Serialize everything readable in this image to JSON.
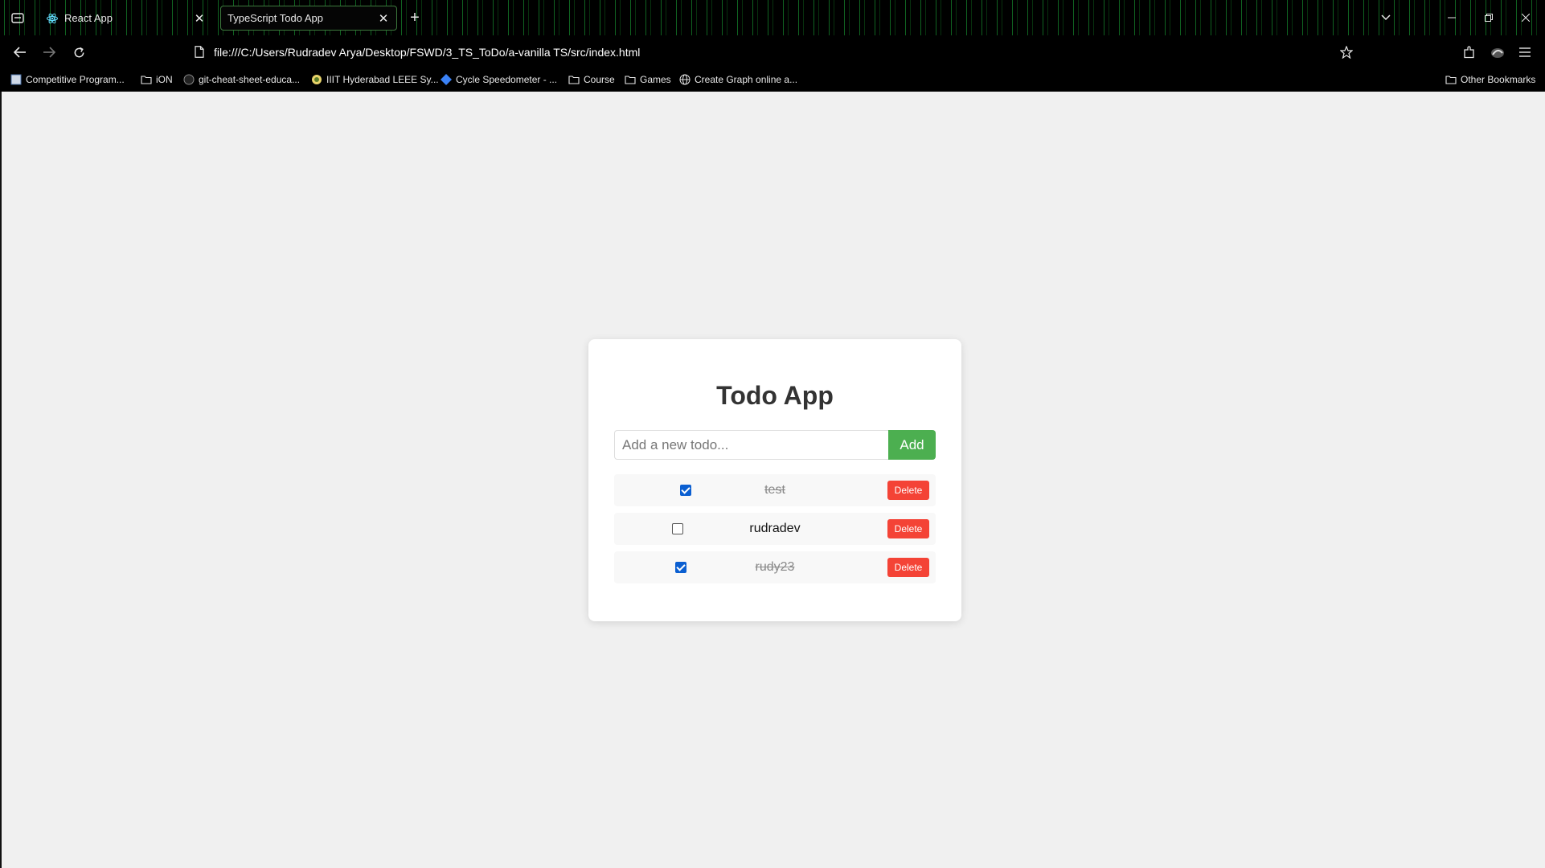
{
  "browser": {
    "tabs": [
      {
        "label": "React App",
        "active": false
      },
      {
        "label": "TypeScript Todo App",
        "active": true
      }
    ],
    "address": "file:///C:/Users/Rudradev Arya/Desktop/FSWD/3_TS_ToDo/a-vanilla TS/src/index.html",
    "bookmarks": [
      {
        "label": "Competitive Program...",
        "icon": "site-icon"
      },
      {
        "label": "iON",
        "icon": "folder-icon"
      },
      {
        "label": "git-cheat-sheet-educa...",
        "icon": "github-icon"
      },
      {
        "label": "IIIT Hyderabad LEEE Sy...",
        "icon": "site-icon"
      },
      {
        "label": "Cycle Speedometer - ...",
        "icon": "diamond-icon"
      },
      {
        "label": "Course",
        "icon": "folder-icon"
      },
      {
        "label": "Games",
        "icon": "folder-icon"
      },
      {
        "label": "Create Graph online a...",
        "icon": "globe-icon"
      }
    ],
    "other_bookmarks": "Other Bookmarks"
  },
  "app": {
    "title": "Todo App",
    "input": {
      "placeholder": "Add a new todo...",
      "value": ""
    },
    "add_label": "Add",
    "delete_label": "Delete",
    "todos": [
      {
        "text": "test",
        "completed": true
      },
      {
        "text": "rudradev",
        "completed": false
      },
      {
        "text": "rudy23",
        "completed": true
      }
    ]
  },
  "colors": {
    "add_button": "#4caf50",
    "delete_button": "#f44336",
    "checkbox_checked": "#0b5fd1"
  }
}
